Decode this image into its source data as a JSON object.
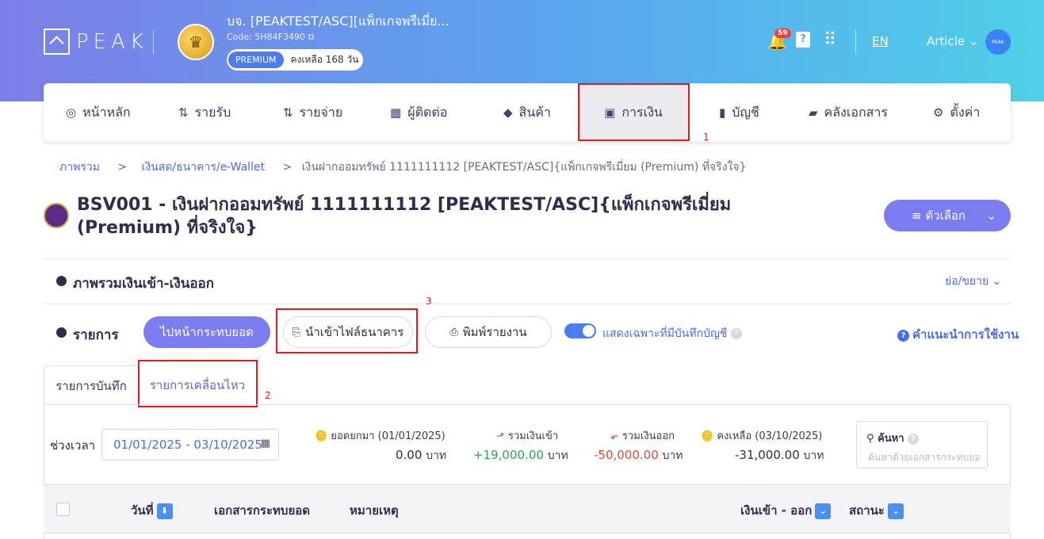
{
  "header": {
    "logo_text": "PEAK",
    "company_name": "บจ. [PEAKTEST/ASC][แพ็กเกจพรีเมี่ย...",
    "company_code": "Code: 5H84F3490",
    "plan_badge": "PREMIUM",
    "plan_remaining": "คงเหลือ 168 วัน",
    "notification_count": "59",
    "language": "EN",
    "article_label": "Article",
    "avatar_text": "PEAK",
    "crown_label": "PREMIUM"
  },
  "nav": {
    "items": [
      {
        "label": "หน้าหลัก",
        "icon": "dashboard-icon"
      },
      {
        "label": "รายรับ",
        "icon": "income-icon"
      },
      {
        "label": "รายจ่าย",
        "icon": "expense-icon"
      },
      {
        "label": "ผู้ติดต่อ",
        "icon": "contacts-icon"
      },
      {
        "label": "สินค้า",
        "icon": "box-icon"
      },
      {
        "label": "การเงิน",
        "icon": "money-icon"
      },
      {
        "label": "บัญชี",
        "icon": "ledger-icon"
      },
      {
        "label": "คลังเอกสาร",
        "icon": "folder-icon"
      },
      {
        "label": "ตั้งค่า",
        "icon": "gear-icon"
      }
    ],
    "active_index": 5
  },
  "annotations": {
    "label1": "1",
    "label2": "2",
    "label3": "3"
  },
  "breadcrumb": {
    "home": "ภาพรวม",
    "sep": ">",
    "level2": "เงินสด/ธนาคาร/e-Wallet",
    "current": "เงินฝากออมทรัพย์ 1111111112 [PEAKTEST/ASC]{แพ็กเกจพรีเมี่ยม (Premium) ที่จริงใจ}"
  },
  "page": {
    "title": "BSV001 - เงินฝากออมทรัพย์ 1111111112 [PEAKTEST/ASC]{แพ็กเกจพรีเมี่ยม (Premium) ที่จริงใจ}",
    "options_button": "≡ ตัวเลือก"
  },
  "summary_section": {
    "title": "ภาพรวมเงินเข้า-เงินออก",
    "collapse_label": "ย่อ/ขยาย"
  },
  "transactions_section": {
    "title": "รายการ",
    "reconcile_button": "ไปหน้ากระทบยอด",
    "import_button": "นำเข้าไฟล์ธนาคาร",
    "print_button": "พิมพ์รายงาน",
    "toggle_label": "แสดงเฉพาะที่มีบันทึกบัญชี",
    "toggle_on": true,
    "help_label": "คำแนะนำการใช้งาน"
  },
  "tabs": [
    {
      "label": "รายการบันทึก"
    },
    {
      "label": "รายการเคลื่อนไหว"
    }
  ],
  "filters": {
    "period_label": "ช่วงเวลา",
    "date_range": "01/01/2025 - 03/10/2025",
    "search_label": "ค้นหา",
    "search_placeholder": "ค้นหาด้วยเอกสารกระทบยอด"
  },
  "stats": {
    "unit": "บาท",
    "opening": {
      "label": "ยอดยกมา (01/01/2025)",
      "value": "0.00"
    },
    "inflow": {
      "label": "รวมเงินเข้า",
      "value": "+19,000.00"
    },
    "outflow": {
      "label": "รวมเงินออก",
      "value": "-50,000.00"
    },
    "balance": {
      "label": "คงเหลือ (03/10/2025)",
      "value": "-31,000.00"
    },
    "colors": {
      "inflow": "#2aa84a",
      "outflow": "#e8462c"
    }
  },
  "table": {
    "columns": [
      "วันที่",
      "เอกสารกระทบยอด",
      "หมายเหตุ",
      "เงินเข้า - ออก",
      "สถานะ"
    ]
  },
  "colors": {
    "accent": "#7a7cf0",
    "link": "#4a6cf0",
    "annotation_red": "#e31b1b"
  }
}
